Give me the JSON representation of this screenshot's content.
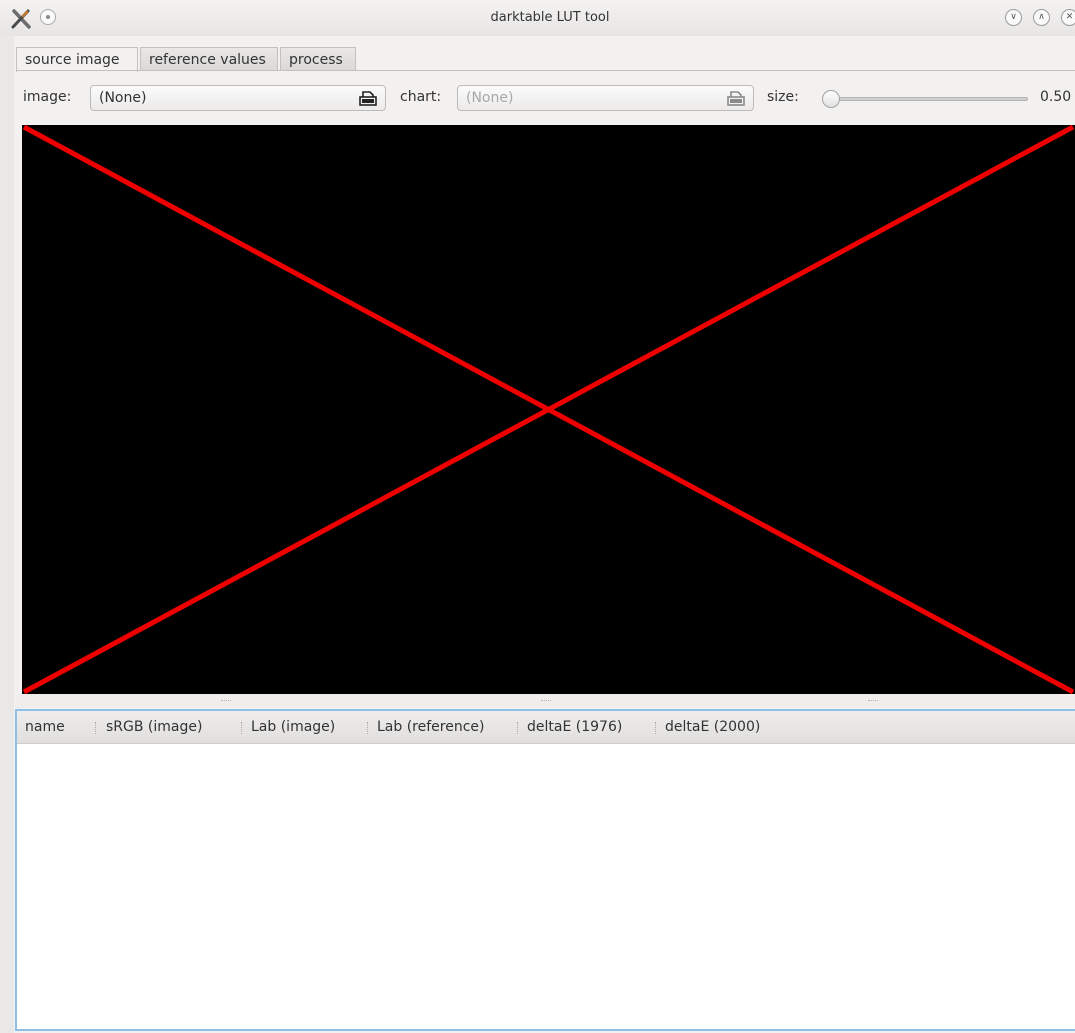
{
  "window": {
    "title": "darktable LUT tool",
    "controls": [
      "chevron-down-icon",
      "chevron-up-icon",
      "close-icon"
    ]
  },
  "tabs": [
    {
      "label": "source image",
      "active": true
    },
    {
      "label": "reference values",
      "active": false
    },
    {
      "label": "process",
      "active": false
    }
  ],
  "toolbar": {
    "image_label": "image:",
    "image_value": "(None)",
    "chart_label": "chart:",
    "chart_value": "(None)",
    "size_label": "size:",
    "size_value": "0.50",
    "size_slider_fraction": 0.0
  },
  "preview": {
    "placeholder": "red X (no image loaded)",
    "background": "#000000",
    "cross_color": "#ee0000"
  },
  "table": {
    "columns": [
      "name",
      "sRGB (image)",
      "Lab (image)",
      "Lab (reference)",
      "deltaE (1976)",
      "deltaE (2000)"
    ],
    "rows": []
  },
  "colors": {
    "accent_focus": "#8cc0e8",
    "window_bg": "#f2f1f0"
  }
}
